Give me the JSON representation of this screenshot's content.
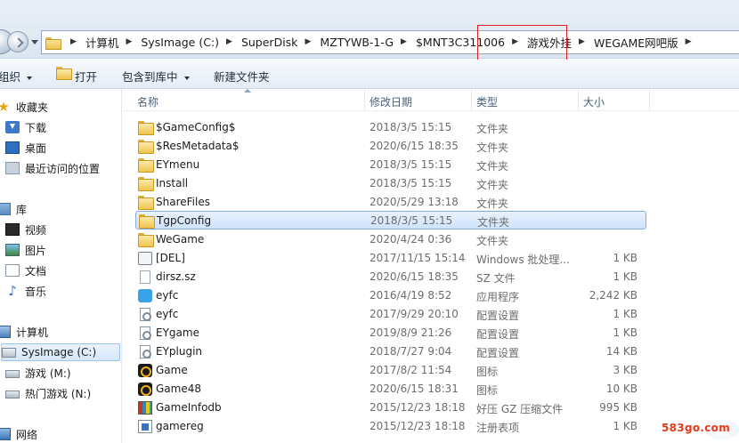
{
  "address_bar": {
    "crumbs": [
      "计算机",
      "SysImage (C:)",
      "SuperDisk",
      "MZTYWB-1-G",
      "$MNT3C311006",
      "游戏外挂",
      "WEGAME网吧版"
    ]
  },
  "toolbar": {
    "organize_label": "组织",
    "open_label": "打开",
    "include_in_library_label": "包含到库中",
    "new_folder_label": "新建文件夹"
  },
  "nav_pane": {
    "favorites_label": "收藏夹",
    "download_label": "下载",
    "desktop_label": "桌面",
    "recent_places_label": "最近访问的位置",
    "libraries_label": "库",
    "videos_label": "视频",
    "pictures_label": "图片",
    "documents_label": "文档",
    "music_label": "音乐",
    "computer_label": "计算机",
    "drive_c_label": "SysImage (C:)",
    "drive_m_label": "游戏 (M:)",
    "drive_n_label": "热门游戏 (N:)",
    "network_label": "网络"
  },
  "columns": {
    "name": "名称",
    "date": "修改日期",
    "type": "类型",
    "size": "大小"
  },
  "files": [
    {
      "name": "$GameConfig$",
      "date": "2018/3/5 15:15",
      "type": "文件夹",
      "size": "",
      "icon": "folder-icon"
    },
    {
      "name": "$ResMetadata$",
      "date": "2020/6/15 18:35",
      "type": "文件夹",
      "size": "",
      "icon": "folder-icon"
    },
    {
      "name": "EYmenu",
      "date": "2018/3/5 15:15",
      "type": "文件夹",
      "size": "",
      "icon": "folder-icon"
    },
    {
      "name": "Install",
      "date": "2018/3/5 15:15",
      "type": "文件夹",
      "size": "",
      "icon": "folder-icon"
    },
    {
      "name": "ShareFiles",
      "date": "2020/5/29 13:18",
      "type": "文件夹",
      "size": "",
      "icon": "folder-icon"
    },
    {
      "name": "TgpConfig",
      "date": "2018/3/5 15:15",
      "type": "文件夹",
      "size": "",
      "icon": "folder-icon"
    },
    {
      "name": "WeGame",
      "date": "2020/4/24 0:36",
      "type": "文件夹",
      "size": "",
      "icon": "folder-icon"
    },
    {
      "name": "[DEL]",
      "date": "2017/11/15 15:14",
      "type": "Windows 批处理...",
      "size": "1 KB",
      "icon": "batch-file-icon"
    },
    {
      "name": "dirsz.sz",
      "date": "2020/6/15 18:35",
      "type": "SZ 文件",
      "size": "1 KB",
      "icon": "file-icon"
    },
    {
      "name": "eyfc",
      "date": "2016/4/19 8:52",
      "type": "应用程序",
      "size": "2,242 KB",
      "icon": "application-icon"
    },
    {
      "name": "eyfc",
      "date": "2017/9/29 20:10",
      "type": "配置设置",
      "size": "1 KB",
      "icon": "config-file-icon"
    },
    {
      "name": "EYgame",
      "date": "2019/8/9 21:26",
      "type": "配置设置",
      "size": "1 KB",
      "icon": "config-file-icon"
    },
    {
      "name": "EYplugin",
      "date": "2018/7/27 9:04",
      "type": "配置设置",
      "size": "14 KB",
      "icon": "config-file-icon"
    },
    {
      "name": "Game",
      "date": "2017/8/2 11:54",
      "type": "图标",
      "size": "3 KB",
      "icon": "game-icon"
    },
    {
      "name": "Game48",
      "date": "2020/6/15 18:31",
      "type": "图标",
      "size": "10 KB",
      "icon": "game-icon"
    },
    {
      "name": "GameInfodb",
      "date": "2015/12/23 18:18",
      "type": "好压 GZ 压缩文件",
      "size": "995 KB",
      "icon": "archive-icon"
    },
    {
      "name": "gamereg",
      "date": "2015/12/23 18:18",
      "type": "注册表项",
      "size": "1 KB",
      "icon": "registry-icon"
    }
  ],
  "watermark": "583go.com"
}
